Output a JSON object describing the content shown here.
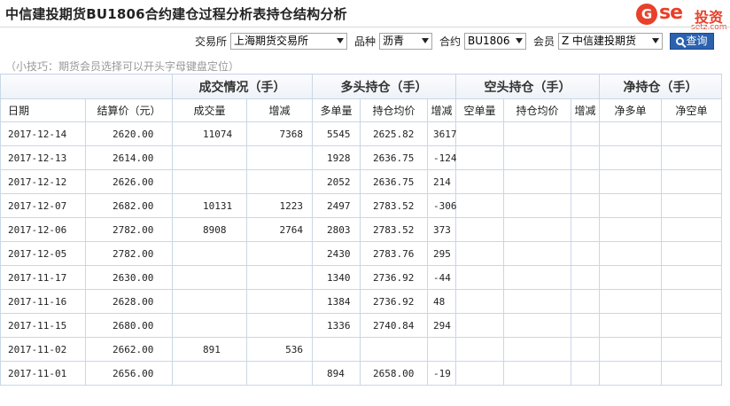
{
  "title": "中信建投期货BU1806合约建仓过程分析表持仓结构分析",
  "logo": {
    "mark": "G",
    "text": "se",
    "cn": "投资",
    "sub": "setz.com"
  },
  "filters": {
    "exchange_label": "交易所",
    "exchange_value": "上海期货交易所",
    "product_label": "品种",
    "product_value": "沥青",
    "contract_label": "合约",
    "contract_value": "BU1806",
    "member_label": "会员",
    "member_value": "Z 中信建投期货",
    "query_label": "查询"
  },
  "hint": "（小技巧：期货会员选择可以开头字母键盘定位）",
  "table": {
    "groups": [
      "成交情况（手）",
      "多头持仓（手）",
      "空头持仓（手）",
      "净持仓（手）"
    ],
    "columns": [
      "日期",
      "结算价（元）",
      "成交量",
      "增减",
      "多单量",
      "持仓均价",
      "增减",
      "空单量",
      "持仓均价",
      "增减",
      "净多单",
      "净空单"
    ],
    "rows": [
      {
        "date": "2017-12-14",
        "price": "2620.00",
        "vol": "11074",
        "vol_chg": "7368",
        "long": "5545",
        "long_avg": "2625.82",
        "long_chg": "3617"
      },
      {
        "date": "2017-12-13",
        "price": "2614.00",
        "vol": "",
        "vol_chg": "",
        "long": "1928",
        "long_avg": "2636.75",
        "long_chg": "-124"
      },
      {
        "date": "2017-12-12",
        "price": "2626.00",
        "vol": "",
        "vol_chg": "",
        "long": "2052",
        "long_avg": "2636.75",
        "long_chg": "214"
      },
      {
        "date": "2017-12-07",
        "price": "2682.00",
        "vol": "10131",
        "vol_chg": "1223",
        "long": "2497",
        "long_avg": "2783.52",
        "long_chg": "-306"
      },
      {
        "date": "2017-12-06",
        "price": "2782.00",
        "vol": "8908",
        "vol_chg": "2764",
        "long": "2803",
        "long_avg": "2783.52",
        "long_chg": "373"
      },
      {
        "date": "2017-12-05",
        "price": "2782.00",
        "vol": "",
        "vol_chg": "",
        "long": "2430",
        "long_avg": "2783.76",
        "long_chg": "295"
      },
      {
        "date": "2017-11-17",
        "price": "2630.00",
        "vol": "",
        "vol_chg": "",
        "long": "1340",
        "long_avg": "2736.92",
        "long_chg": "-44"
      },
      {
        "date": "2017-11-16",
        "price": "2628.00",
        "vol": "",
        "vol_chg": "",
        "long": "1384",
        "long_avg": "2736.92",
        "long_chg": "48"
      },
      {
        "date": "2017-11-15",
        "price": "2680.00",
        "vol": "",
        "vol_chg": "",
        "long": "1336",
        "long_avg": "2740.84",
        "long_chg": "294"
      },
      {
        "date": "2017-11-02",
        "price": "2662.00",
        "vol": "891",
        "vol_chg": "536",
        "long": "",
        "long_avg": "",
        "long_chg": ""
      },
      {
        "date": "2017-11-01",
        "price": "2656.00",
        "vol": "",
        "vol_chg": "",
        "long": "894",
        "long_avg": "2658.00",
        "long_chg": "-19"
      }
    ]
  },
  "colors": {
    "increase": "#d40000",
    "decrease": "#008a00",
    "accent": "#2b62b0",
    "logo": "#e8402a"
  }
}
